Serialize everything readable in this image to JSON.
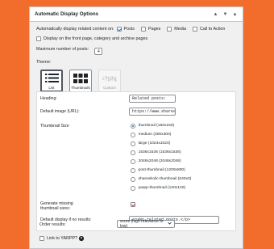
{
  "panel": {
    "title": "Automatic Display Options",
    "buttons": [
      "▲",
      "▼",
      "▲"
    ]
  },
  "auto_display": {
    "label": "Automatically display related content on:",
    "options": [
      {
        "label": "Posts",
        "checked": true
      },
      {
        "label": "Pages",
        "checked": false
      },
      {
        "label": "Media",
        "checked": false
      },
      {
        "label": "Call to Action",
        "checked": false
      }
    ]
  },
  "front_page": {
    "label": "Display on the front page, category and archive pages",
    "checked": false
  },
  "max_posts": {
    "label": "Maximum number of posts:",
    "value": "4"
  },
  "theme": {
    "label": "Theme:",
    "options": [
      {
        "label": "List",
        "selected": true
      },
      {
        "label": "Thumbnails",
        "selected": false
      },
      {
        "label": "Custom",
        "selected": false
      }
    ]
  },
  "heading": {
    "label": "Heading:",
    "value": "Related posts:"
  },
  "default_image": {
    "label": "Default image (URL):",
    "value": "https://www.shareab"
  },
  "thumbnail_size": {
    "label": "Thumbnail Size",
    "options": [
      {
        "label": "thumbnail (150x150)",
        "checked": true
      },
      {
        "label": "medium (300x300)",
        "checked": false
      },
      {
        "label": "large (1024x1024)",
        "checked": false
      },
      {
        "label": "1536x1536 (1536x1536)",
        "checked": false
      },
      {
        "label": "2048x2048 (2048x2048)",
        "checked": false
      },
      {
        "label": "post-thumbnail (1200x800)",
        "checked": false
      },
      {
        "label": "shareaholic-thumbnail (640x0)",
        "checked": false
      },
      {
        "label": "yarpp-thumbnail (120x120)",
        "checked": false
      }
    ]
  },
  "generate_thumbnails": {
    "label": "Generate missing thumbnail sizes:",
    "checked": true
  },
  "no_results": {
    "label": "Default display if no results:",
    "value": "<p>No related posts.</p>"
  },
  "order": {
    "label": "Order results:",
    "value": "score (high relevance to low)"
  },
  "link_yarpp": {
    "label": "Link to YARPP?",
    "checked": false,
    "help": "?"
  },
  "colors": {
    "accent": "#2271b1",
    "check_red": "#d63638",
    "background": "#f26d2b"
  }
}
